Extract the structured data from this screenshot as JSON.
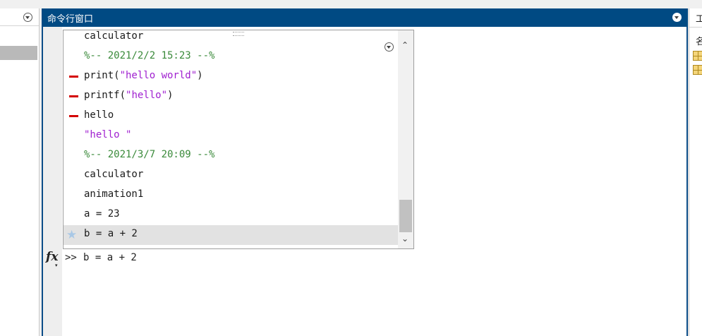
{
  "left_panel": {
    "dropdown_icon": "dropdown-circle-icon"
  },
  "command_window": {
    "title": "命令行窗口",
    "prompt": ">>",
    "current_input": "b = a + 2",
    "fx_label": "fx",
    "fx_caret": "▾"
  },
  "history": {
    "lines": [
      {
        "text": "calculator",
        "style": "normal",
        "marker": false
      },
      {
        "text": "%-- 2021/2/2 15:23 --%",
        "style": "green",
        "marker": false
      },
      {
        "text": "print(\"hello world\")",
        "style": "mixed",
        "marker": true,
        "prefix": "print(",
        "arg": "\"hello world\"",
        "suffix": ")"
      },
      {
        "text": "printf(\"hello\")",
        "style": "mixed",
        "marker": true,
        "prefix": "printf(",
        "arg": "\"hello\"",
        "suffix": ")"
      },
      {
        "text": "hello",
        "style": "normal",
        "marker": true
      },
      {
        "text": "\"hello \"",
        "style": "purple",
        "marker": false
      },
      {
        "text": "%-- 2021/3/7 20:09 --%",
        "style": "green",
        "marker": false
      },
      {
        "text": "calculator",
        "style": "normal",
        "marker": false
      },
      {
        "text": "animation1",
        "style": "normal",
        "marker": false
      },
      {
        "text": "a = 23",
        "style": "normal",
        "marker": false
      },
      {
        "text": "b = a + 2",
        "style": "normal",
        "marker": false,
        "selected": true
      }
    ],
    "scroll_up": "⌃",
    "scroll_down": "⌄"
  },
  "right_panel": {
    "title": "工",
    "column_label": "名"
  },
  "colors": {
    "title_bar": "#004a83",
    "error_marker": "#d40000",
    "comment": "#3a8a3a",
    "string": "#a020d0"
  }
}
